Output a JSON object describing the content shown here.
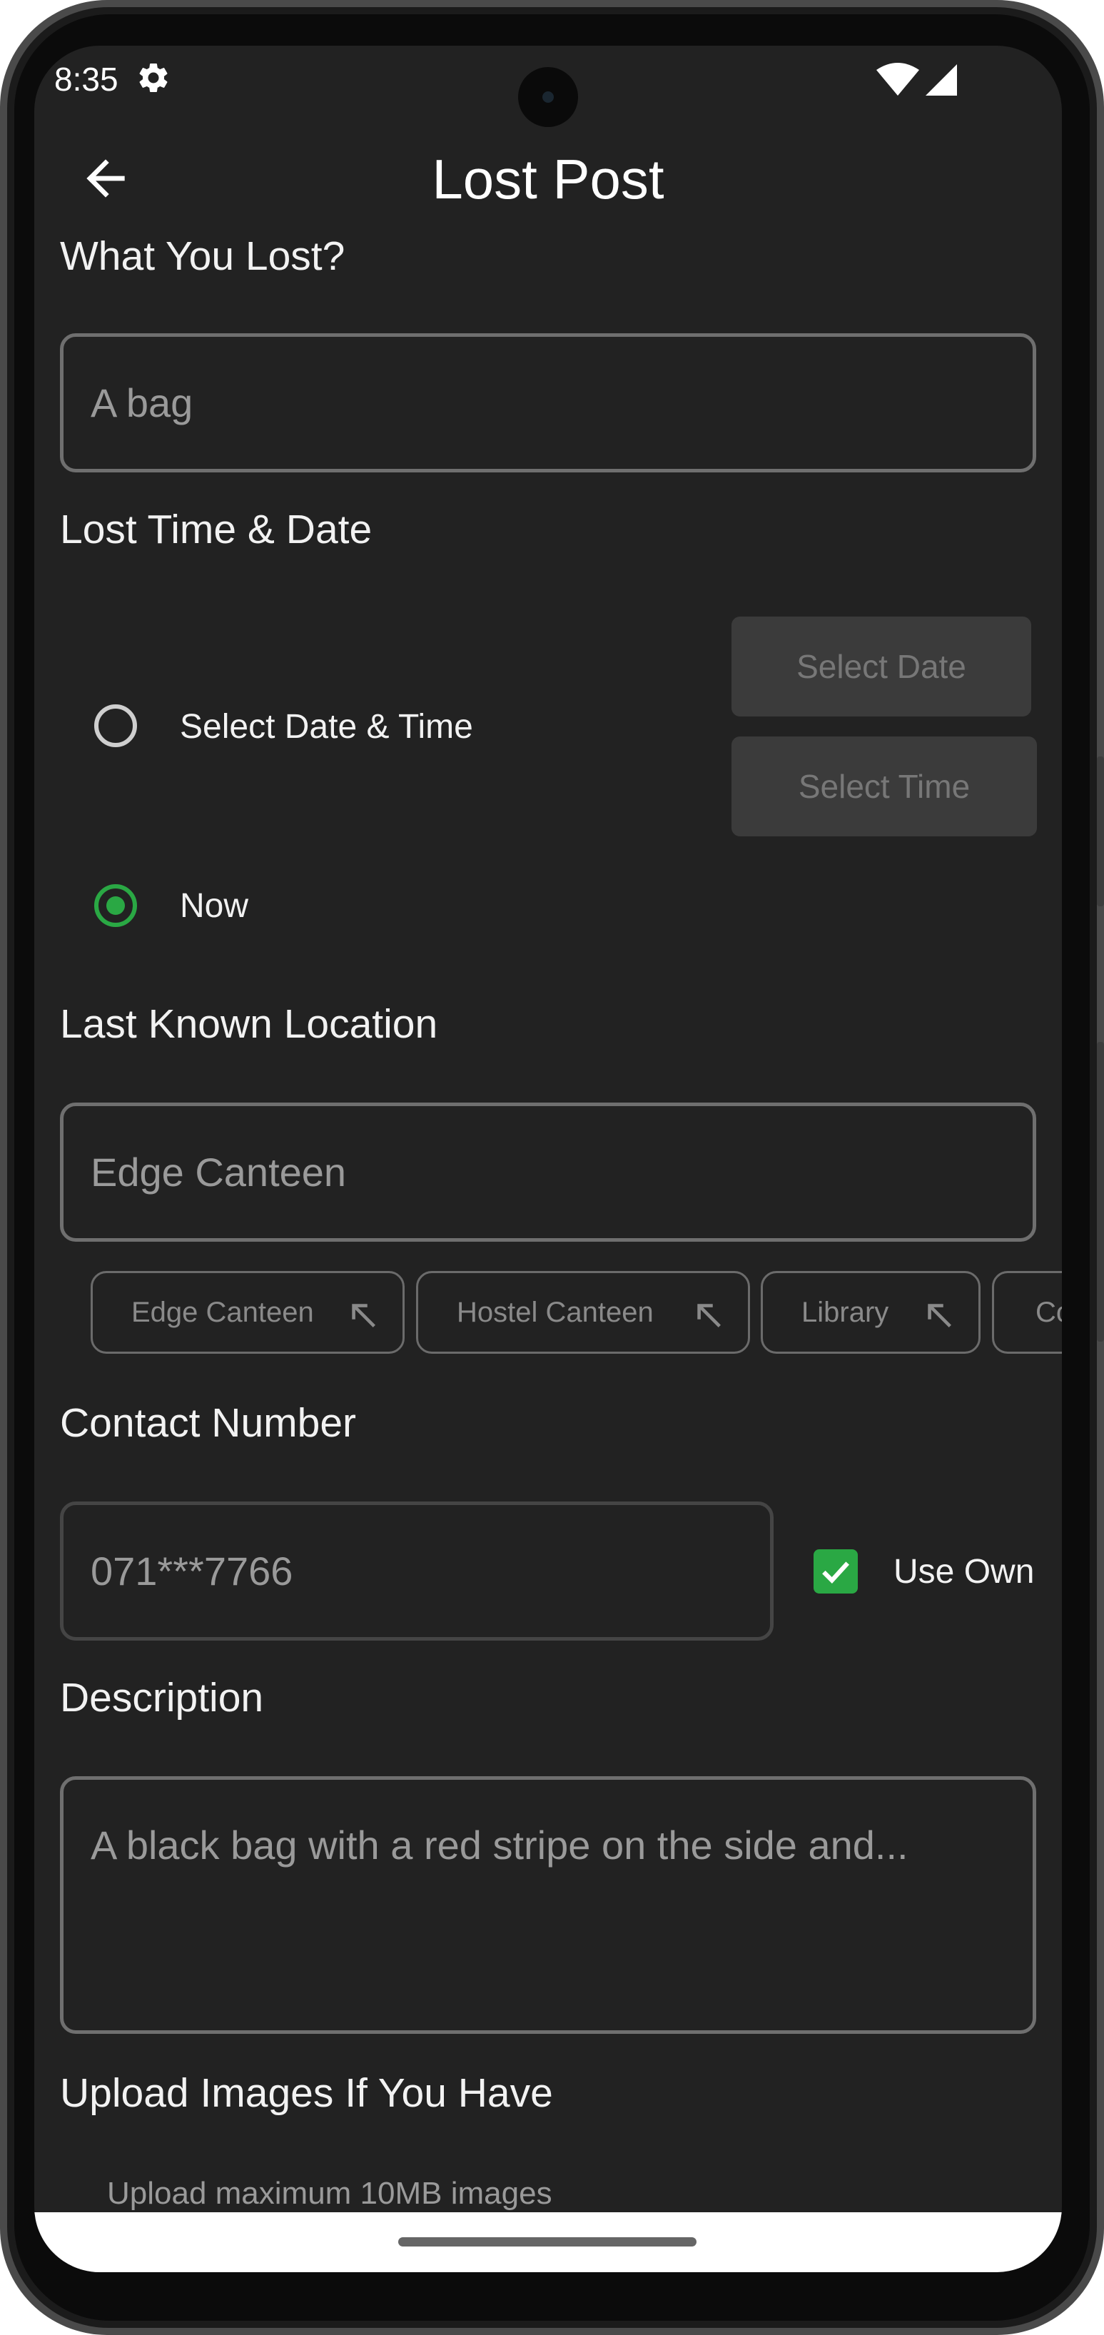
{
  "status_bar": {
    "time": "8:35",
    "settings_icon": "gear-icon",
    "wifi_icon": "wifi-icon",
    "signal_icon": "signal-icon"
  },
  "app_bar": {
    "title": "Lost Post",
    "back_icon": "arrow-left-icon"
  },
  "form": {
    "what_lost": {
      "label": "What You Lost?",
      "placeholder": "A bag"
    },
    "lost_time": {
      "label": "Lost Time & Date",
      "options": [
        {
          "label": "Select Date & Time",
          "selected": false
        },
        {
          "label": "Now",
          "selected": true
        }
      ],
      "select_date_button": "Select Date",
      "select_time_button": "Select Time"
    },
    "location": {
      "label": "Last Known Location",
      "placeholder": "Edge Canteen",
      "suggestions": [
        "Edge Canteen",
        "Hostel Canteen",
        "Library",
        "Co"
      ]
    },
    "contact": {
      "label": "Contact Number",
      "placeholder": "071***7766",
      "use_own_label": "Use Own",
      "use_own_checked": true
    },
    "description": {
      "label": "Description",
      "placeholder": "A black bag with a red stripe on the side and..."
    },
    "upload": {
      "label": "Upload Images If You Have",
      "hint": "Upload maximum 10MB images"
    }
  },
  "colors": {
    "background": "#222222",
    "accent": "#2aa844",
    "border": "#6f6f6f",
    "placeholder": "#9a9a9a"
  }
}
